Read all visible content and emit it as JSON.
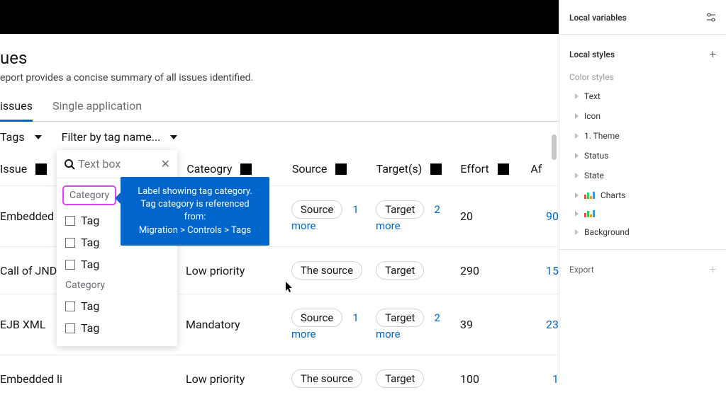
{
  "page": {
    "title": "ues",
    "description": "eport provides a concise summary of all issues identified."
  },
  "tabs": {
    "active": "issues",
    "other": "Single application"
  },
  "filter": {
    "tags_label": "Tags",
    "by_name_label": "Filter by tag name..."
  },
  "table": {
    "headers": {
      "issue": "Issue",
      "category": "Cateogry",
      "source": "Source",
      "targets": "Target(s)",
      "effort": "Effort",
      "affected": "Af"
    },
    "rows": [
      {
        "issue": "Embedded f",
        "category": "",
        "source": "Source",
        "src_more": "1 more",
        "target": "Target",
        "tgt_more": "2 more",
        "effort": "20",
        "affected": "90"
      },
      {
        "issue": "Call of JNDI ",
        "category": "Low priority",
        "source": "The source",
        "src_more": "",
        "target": "Target",
        "tgt_more": "",
        "effort": "290",
        "affected": "15"
      },
      {
        "issue": "EJB XML",
        "category": "Mandatory",
        "source": "Source",
        "src_more": "1 more",
        "target": "Target",
        "tgt_more": "2 more",
        "effort": "39",
        "affected": "23"
      },
      {
        "issue": "Embedded li",
        "category": "Low priority",
        "source": "The source",
        "src_more": "",
        "target": "Target",
        "tgt_more": "",
        "effort": "100",
        "affected": "1"
      }
    ]
  },
  "dropdown": {
    "search_placeholder": "Text box",
    "category_label": "Category",
    "items": [
      "Tag",
      "Tag",
      "Tag"
    ],
    "category_label2": "Category",
    "items2": [
      "Tag",
      "Tag"
    ]
  },
  "tooltip": {
    "line1": "Label showing tag category.",
    "line2": "Tag category is referenced from:",
    "line3": "Migration > Controls > Tags"
  },
  "right": {
    "local_vars": "Local variables",
    "local_styles": "Local styles",
    "color_styles": "Color styles",
    "items": [
      "Text",
      "Icon",
      "1. Theme",
      "Status",
      "State",
      "Charts",
      "",
      "Background"
    ],
    "export": "Export"
  }
}
